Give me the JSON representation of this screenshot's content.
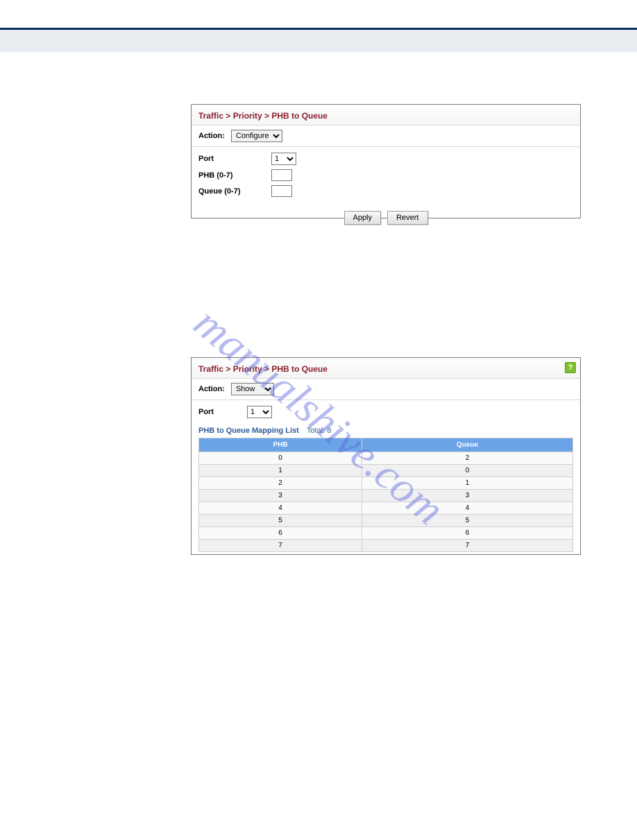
{
  "topbar": {},
  "panel1": {
    "breadcrumb": "Traffic > Priority > PHB to Queue",
    "action_label": "Action:",
    "action_value": "Configure",
    "port_label": "Port",
    "port_value": "1",
    "phb_label": "PHB (0-7)",
    "phb_value": "",
    "queue_label": "Queue (0-7)",
    "queue_value": "",
    "apply": "Apply",
    "revert": "Revert"
  },
  "panel2": {
    "breadcrumb": "Traffic > Priority > PHB to Queue",
    "help": "?",
    "action_label": "Action:",
    "action_value": "Show",
    "port_label": "Port",
    "port_value": "1",
    "list_label": "PHB to Queue Mapping List",
    "total_label": "Total: 8",
    "col_phb": "PHB",
    "col_queue": "Queue",
    "rows": [
      {
        "phb": "0",
        "queue": "2"
      },
      {
        "phb": "1",
        "queue": "0"
      },
      {
        "phb": "2",
        "queue": "1"
      },
      {
        "phb": "3",
        "queue": "3"
      },
      {
        "phb": "4",
        "queue": "4"
      },
      {
        "phb": "5",
        "queue": "5"
      },
      {
        "phb": "6",
        "queue": "6"
      },
      {
        "phb": "7",
        "queue": "7"
      }
    ]
  },
  "watermark": "manualshive.com"
}
